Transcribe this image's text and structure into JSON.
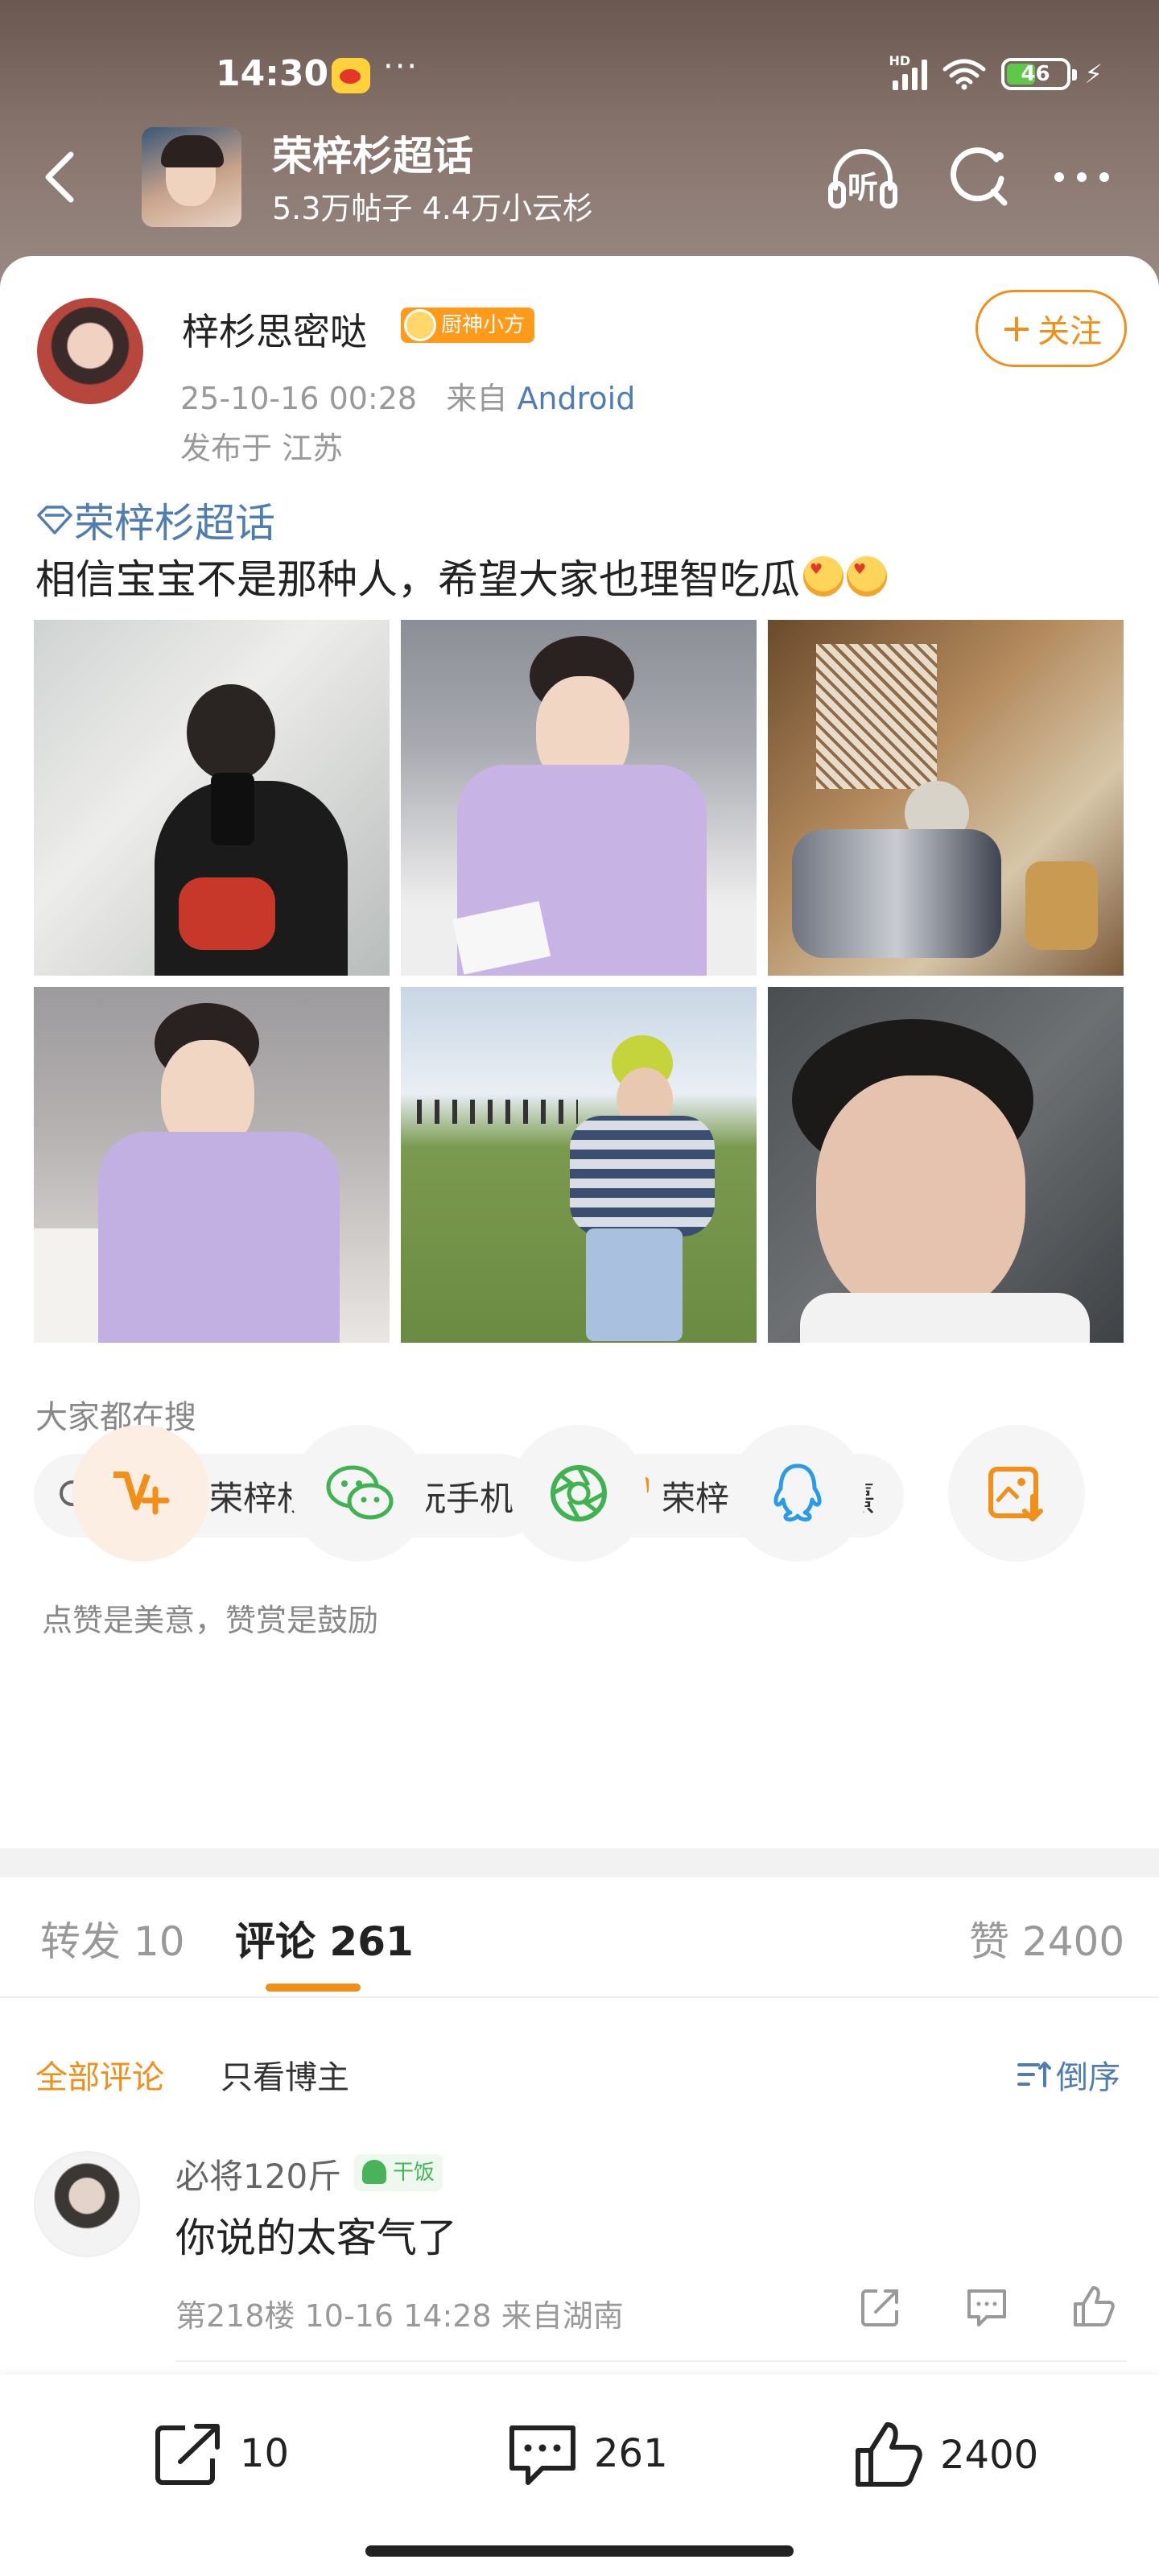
{
  "status_bar": {
    "time": "14:30",
    "dots": "···",
    "battery": "46",
    "network": "HD"
  },
  "header": {
    "back_icon": "chevron-left-icon",
    "topic_title": "荣梓杉超话",
    "topic_stats": "5.3万帖子 4.4万小云杉",
    "listen_label": "听",
    "listen_icon": "headphones-icon",
    "search_icon": "search-icon",
    "more_icon": "more-icon"
  },
  "post": {
    "author": "梓杉思密哒",
    "author_badge": "厨神小方",
    "follow_label": "关注",
    "date": "25-10-16 00:28",
    "from_prefix": "来自",
    "source": "Android",
    "location": "发布于 江苏",
    "topic_link": "荣梓杉超话",
    "text": "相信宝宝不是那种人，希望大家也理智吃瓜"
  },
  "trending": {
    "title": "大家都在搜",
    "chips": [
      "怪不得荣梓杉花少老玩手机",
      "荣梓杉 李禹熹"
    ]
  },
  "reward": {
    "text": "点赞是美意，赞赏是鼓励"
  },
  "share_buttons": [
    "reward-v-icon",
    "wechat-icon",
    "moments-icon",
    "qq-icon",
    "save-image-icon"
  ],
  "tabs": {
    "repost_label": "转发",
    "repost_count": "10",
    "comment_label": "评论",
    "comment_count": "261",
    "like_label": "赞",
    "like_count": "2400"
  },
  "comment_filter": {
    "all": "全部评论",
    "op_only": "只看博主",
    "sort": "倒序"
  },
  "comments": [
    {
      "user": "必将120斤",
      "badge": "干饭",
      "text": "你说的太客气了",
      "meta": "第218楼 10-16 14:28 来自湖南"
    }
  ],
  "bottom_bar": {
    "repost": "10",
    "comment": "261",
    "like": "2400"
  },
  "colors": {
    "accent": "#f08f1a",
    "link": "#4f7db3",
    "header_bg": "#86736c"
  }
}
